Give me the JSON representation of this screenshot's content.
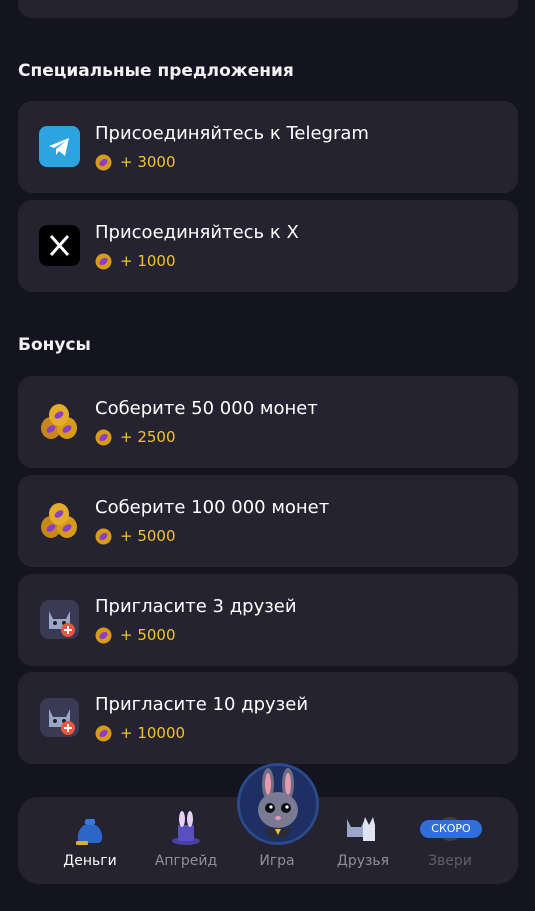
{
  "sections": {
    "special": {
      "title": "Специальные предложения",
      "items": [
        {
          "label": "Присоединяйтесь к Telegram",
          "reward": "+ 3000",
          "icon": "telegram-icon"
        },
        {
          "label": "Присоединяйтесь к X",
          "reward": "+ 1000",
          "icon": "x-icon"
        }
      ]
    },
    "bonuses": {
      "title": "Бонусы",
      "items": [
        {
          "label": "Соберите 50 000 монет",
          "reward": "+ 2500",
          "icon": "coins-icon"
        },
        {
          "label": "Соберите 100 000 монет",
          "reward": "+ 5000",
          "icon": "coins-icon"
        },
        {
          "label": "Пригласите 3 друзей",
          "reward": "+ 5000",
          "icon": "invite-friends-icon"
        },
        {
          "label": "Пригласите 10 друзей",
          "reward": "+ 10000",
          "icon": "invite-friends-icon"
        }
      ]
    }
  },
  "nav": {
    "items": [
      {
        "label": "Деньги",
        "icon": "money-bag-icon",
        "state": "active"
      },
      {
        "label": "Апгрейд",
        "icon": "magic-hat-icon",
        "state": "normal"
      },
      {
        "label": "Игра",
        "icon": "bunny-avatar-icon",
        "state": "normal"
      },
      {
        "label": "Друзья",
        "icon": "friends-icon",
        "state": "normal"
      },
      {
        "label": "Звери",
        "icon": "animals-icon",
        "state": "disabled"
      }
    ],
    "soon_badge": "СКОРО"
  },
  "colors": {
    "background": "#141420",
    "card": "#24232f",
    "reward": "#f2c232",
    "badge": "#2f6fdc"
  }
}
